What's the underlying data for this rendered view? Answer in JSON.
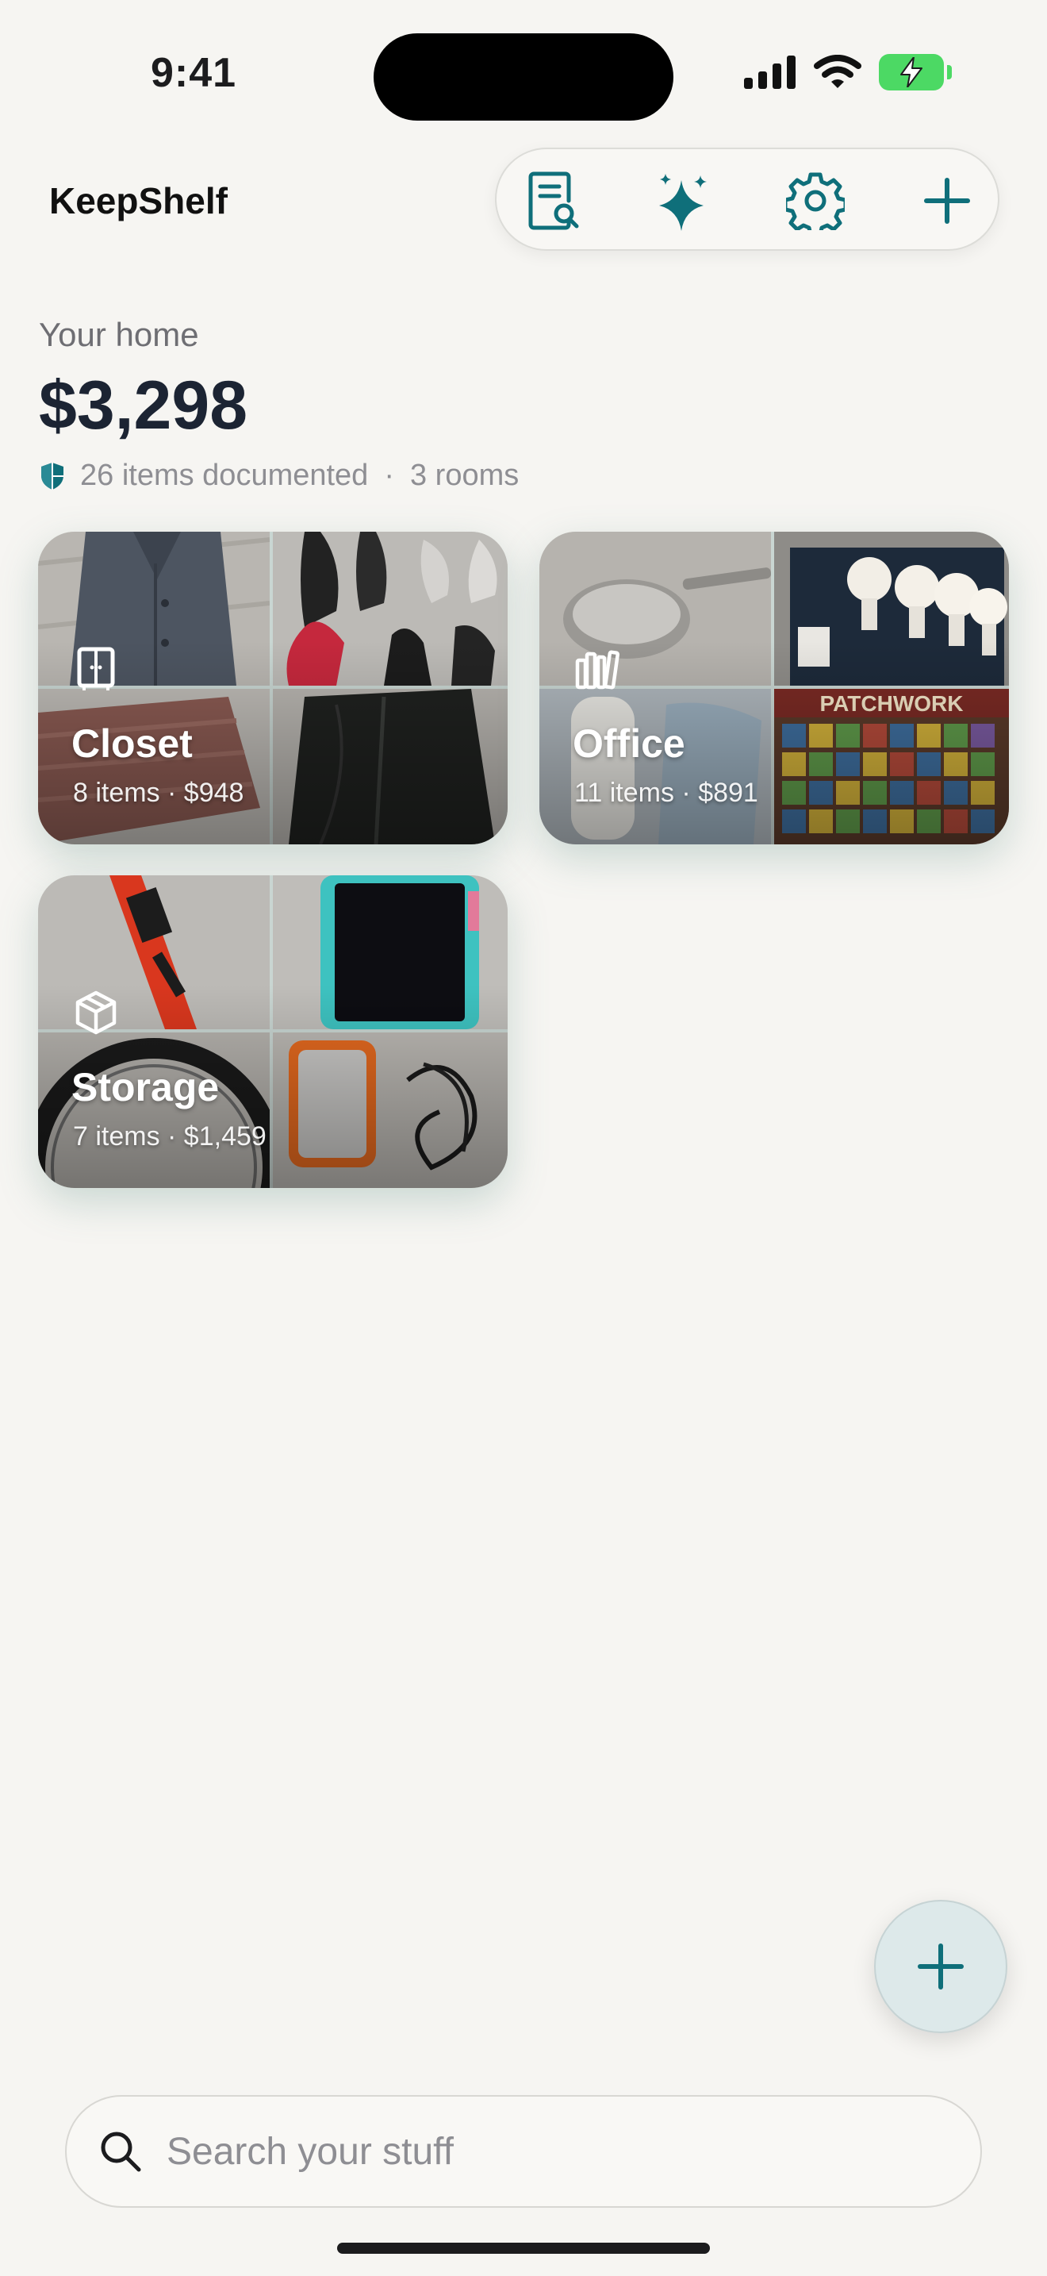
{
  "status_bar": {
    "time": "9:41",
    "icons": [
      "cellular-signal-icon",
      "wifi-icon",
      "battery-charging-icon"
    ]
  },
  "header": {
    "title": "KeepShelf",
    "toolbar": [
      "receipt-search-icon",
      "sparkles-icon",
      "gear-icon",
      "plus-icon"
    ]
  },
  "summary": {
    "label": "Your home",
    "total": "$3,298",
    "items": "26 items documented",
    "separator": "·",
    "rooms": "3 rooms"
  },
  "rooms": [
    {
      "name": "Closet",
      "stats": "8 items  ·  $948",
      "icon": "wardrobe-icon"
    },
    {
      "name": "Office",
      "stats": "11 items  ·  $891",
      "icon": "bookshelf-icon"
    },
    {
      "name": "Storage",
      "stats": "7 items  ·  $1,459",
      "icon": "box-icon"
    }
  ],
  "search": {
    "placeholder": "Search your stuff"
  },
  "colors": {
    "accent": "#0f6f7a",
    "background": "#f6f5f2",
    "battery": "#4cd964"
  }
}
